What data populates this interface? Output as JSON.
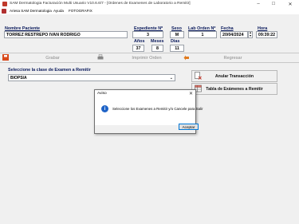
{
  "window": {
    "title": "SAM Dermatologia Facturación Multi Usuario V10.6.6/7 - [Ordenes de Examenes de Laboratorio a Remitir]",
    "min_glyph": "–",
    "max_glyph": "☐",
    "close_glyph": "✕"
  },
  "menu": {
    "items": [
      "Ariesa SAM Dermatologia",
      "Ayuda",
      "FOTOGRAFIX"
    ]
  },
  "patient": {
    "name_label": "Nombre Paciente",
    "name_value": "TORREZ RESTREPO IVAN RODRIGO",
    "expediente_label": "Expediente Nº",
    "expediente_value": "3",
    "sexo_label": "Sexo",
    "sexo_value": "M",
    "orden_label": "Lab Orden Nº",
    "orden_value": "1",
    "fecha_label": "Fecha",
    "fecha_value": "20/04/2024",
    "hora_label": "Hora",
    "hora_value": "09:39:22",
    "anos_label": "Años",
    "anos_value": "37",
    "meses_label": "Meses",
    "meses_value": "8",
    "dias_label": "Dias",
    "dias_value": "11"
  },
  "toolbar": {
    "grabar": "Grabar",
    "imprimir": "Imprimir Orden",
    "regresar": "Regresar"
  },
  "exam": {
    "label": "Seleccione la clase de Examen a Remitir",
    "selected": "BIOPSIA"
  },
  "side_buttons": {
    "anular": "Anular Transacción",
    "tabla": "Tabla de Exámenes a Remitir"
  },
  "dialog": {
    "title": "Aviso",
    "close_glyph": "✕",
    "info_glyph": "i",
    "message": "Seleccione los Examenes a Remitir y/o Cancele para Salir",
    "ok_label": "Aceptar"
  },
  "colors": {
    "label_blue": "#0a1a5c",
    "info_blue": "#1e63c7",
    "focus_border": "#0078d7"
  }
}
